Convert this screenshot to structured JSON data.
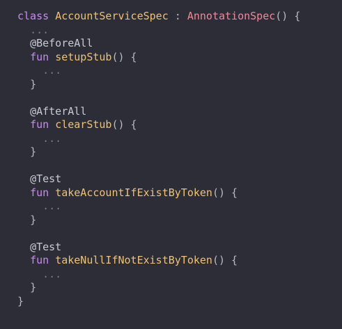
{
  "colors": {
    "background": "#2c2d36",
    "keyword": "#c98bf2",
    "class_name": "#eec373",
    "supertype": "#ee8a9a",
    "function_name": "#eec373",
    "text": "#c9cbd3",
    "ellipsis": "#7b7d89"
  },
  "code": {
    "class_decl": {
      "keyword": "class",
      "name": "AccountServiceSpec",
      "separator": ":",
      "supertype": "AnnotationSpec",
      "open": "() {"
    },
    "class_body_ellipsis": "...",
    "methods": [
      {
        "annotation": "@BeforeAll",
        "keyword": "fun",
        "name": "setupStub",
        "params_open": "() {",
        "body": "...",
        "close": "}"
      },
      {
        "annotation": "@AfterAll",
        "keyword": "fun",
        "name": "clearStub",
        "params_open": "() {",
        "body": "...",
        "close": "}"
      },
      {
        "annotation": "@Test",
        "keyword": "fun",
        "name": "takeAccountIfExistByToken",
        "params_open": "() {",
        "body": "...",
        "close": "}"
      },
      {
        "annotation": "@Test",
        "keyword": "fun",
        "name": "takeNullIfNotExistByToken",
        "params_open": "() {",
        "body": "...",
        "close": "}"
      }
    ],
    "class_close": "}"
  }
}
